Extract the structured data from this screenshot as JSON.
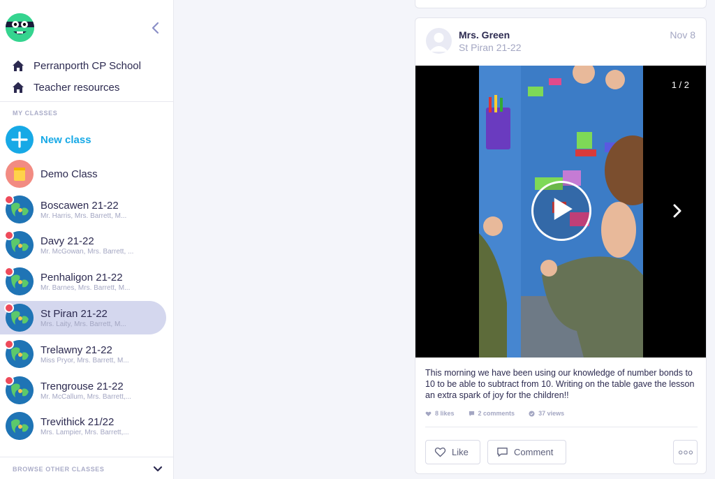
{
  "sidebar": {
    "top_links": [
      {
        "label": "Perranporth CP School",
        "icon": "home-icon"
      },
      {
        "label": "Teacher resources",
        "icon": "home-icon"
      }
    ],
    "my_classes_label": "MY CLASSES",
    "new_class_label": "New class",
    "demo_class_label": "Demo Class",
    "classes": [
      {
        "name": "Boscawen 21-22",
        "teachers": "Mr. Harris, Mrs. Barrett, M..."
      },
      {
        "name": "Davy 21-22",
        "teachers": "Mr. McGowan, Mrs. Barrett, ..."
      },
      {
        "name": "Penhaligon 21-22",
        "teachers": "Mr. Barnes, Mrs. Barrett, M..."
      },
      {
        "name": "St Piran 21-22",
        "teachers": "Mrs. Laity, Mrs. Barrett, M...",
        "active": true
      },
      {
        "name": "Trelawny 21-22",
        "teachers": "Miss Pryor, Mrs. Barrett, M..."
      },
      {
        "name": "Trengrouse 21-22",
        "teachers": "Mr. McCallum, Mrs. Barrett,..."
      },
      {
        "name": "Trevithick 21/22",
        "teachers": "Mrs. Lampier, Mrs. Barrett,..."
      }
    ],
    "browse_label": "BROWSE OTHER CLASSES"
  },
  "post": {
    "author": "Mrs. Green",
    "class_name": "St Piran 21-22",
    "date": "Nov 8",
    "media_counter": "1 / 2",
    "text": "This morning we have been using our knowledge of number bonds to 10 to be able to subtract from 10. Writing on the table gave the lesson an extra spark of joy for the children!!",
    "likes": "8 likes",
    "comments": "2 comments",
    "views": "37 views",
    "like_label": "Like",
    "comment_label": "Comment"
  },
  "colors": {
    "accent_blue": "#17a9e6",
    "active_bg": "#d4d7ee",
    "notification_red": "#ee4a5a",
    "text_dark": "#2c2a50",
    "text_muted": "#a3a6c2"
  }
}
